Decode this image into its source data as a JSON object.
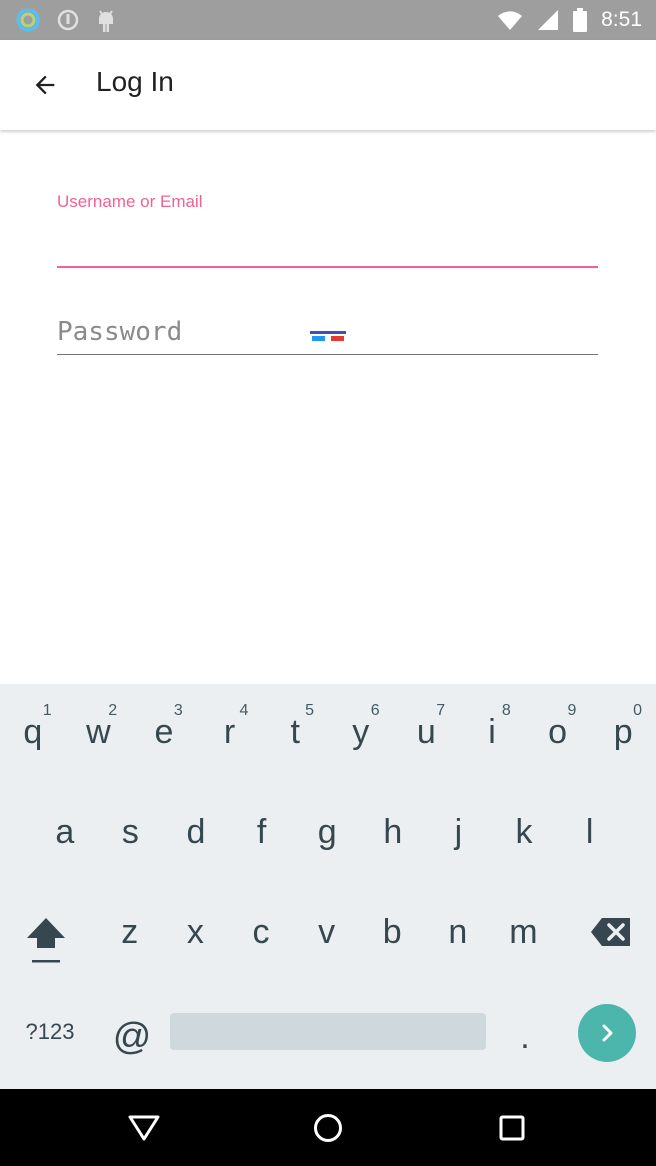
{
  "status_bar": {
    "time": "8:51",
    "icons": [
      "ring-app-icon",
      "info-circle-icon",
      "android-icon",
      "wifi-icon",
      "signal-icon",
      "battery-icon"
    ]
  },
  "app_bar": {
    "title": "Log In",
    "back_icon": "arrow-left-icon"
  },
  "form": {
    "username_label": "Username or Email",
    "username_value": "",
    "password_placeholder": "Password",
    "password_value": ""
  },
  "keyboard": {
    "row1": [
      {
        "key": "q",
        "hint": "1"
      },
      {
        "key": "w",
        "hint": "2"
      },
      {
        "key": "e",
        "hint": "3"
      },
      {
        "key": "r",
        "hint": "4"
      },
      {
        "key": "t",
        "hint": "5"
      },
      {
        "key": "y",
        "hint": "6"
      },
      {
        "key": "u",
        "hint": "7"
      },
      {
        "key": "i",
        "hint": "8"
      },
      {
        "key": "o",
        "hint": "9"
      },
      {
        "key": "p",
        "hint": "0"
      }
    ],
    "row2": [
      "a",
      "s",
      "d",
      "f",
      "g",
      "h",
      "j",
      "k",
      "l"
    ],
    "row3": [
      "z",
      "x",
      "c",
      "v",
      "b",
      "n",
      "m"
    ],
    "symbols_label": "?123",
    "at_label": "@",
    "period_label": ".",
    "accent_color": "#4db6ac"
  },
  "colors": {
    "accent": "#f06292",
    "status_bar": "#9e9e9e",
    "keyboard_bg": "#eceff1",
    "nav_bar": "#000000"
  }
}
